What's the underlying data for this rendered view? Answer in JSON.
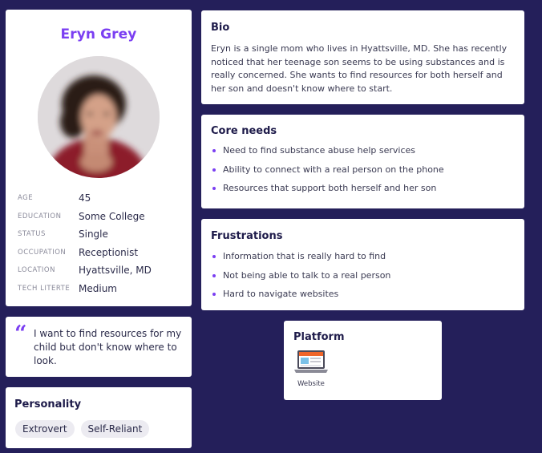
{
  "profile": {
    "name": "Eryn Grey",
    "info": [
      {
        "label": "AGE",
        "value": "45"
      },
      {
        "label": "EDUCATION",
        "value": "Some College"
      },
      {
        "label": "STATUS",
        "value": "Single"
      },
      {
        "label": "OCCUPATION",
        "value": "Receptionist"
      },
      {
        "label": "LOCATION",
        "value": "Hyattsville, MD"
      },
      {
        "label": "TECH LITERTE",
        "value": "Medium"
      }
    ]
  },
  "quote": {
    "mark": "“",
    "text": "I want to find resources for my child but don't know where to look."
  },
  "personality": {
    "title": "Personality",
    "tags": [
      "Extrovert",
      "Self-Reliant"
    ]
  },
  "bio": {
    "title": "Bio",
    "text": "Eryn is a single mom who lives in Hyattsville, MD. She has recently noticed that her teenage son seems to be using substances and is really concerned. She wants to find resources for both herself and her son and doesn't know where to start."
  },
  "core_needs": {
    "title": "Core needs",
    "items": [
      "Need to find substance abuse help services",
      "Ability to connect with a real person on the phone",
      "Resources that support both herself and her son"
    ]
  },
  "frustrations": {
    "title": "Frustrations",
    "items": [
      "Information that is really hard to find",
      "Not being able to talk to a real person",
      "Hard to navigate websites"
    ]
  },
  "platform": {
    "title": "Platform",
    "items": [
      {
        "label": "Website",
        "icon": "laptop-website-icon"
      }
    ]
  },
  "colors": {
    "background": "#241f5a",
    "accent": "#7b3ff2",
    "card": "#ffffff"
  }
}
